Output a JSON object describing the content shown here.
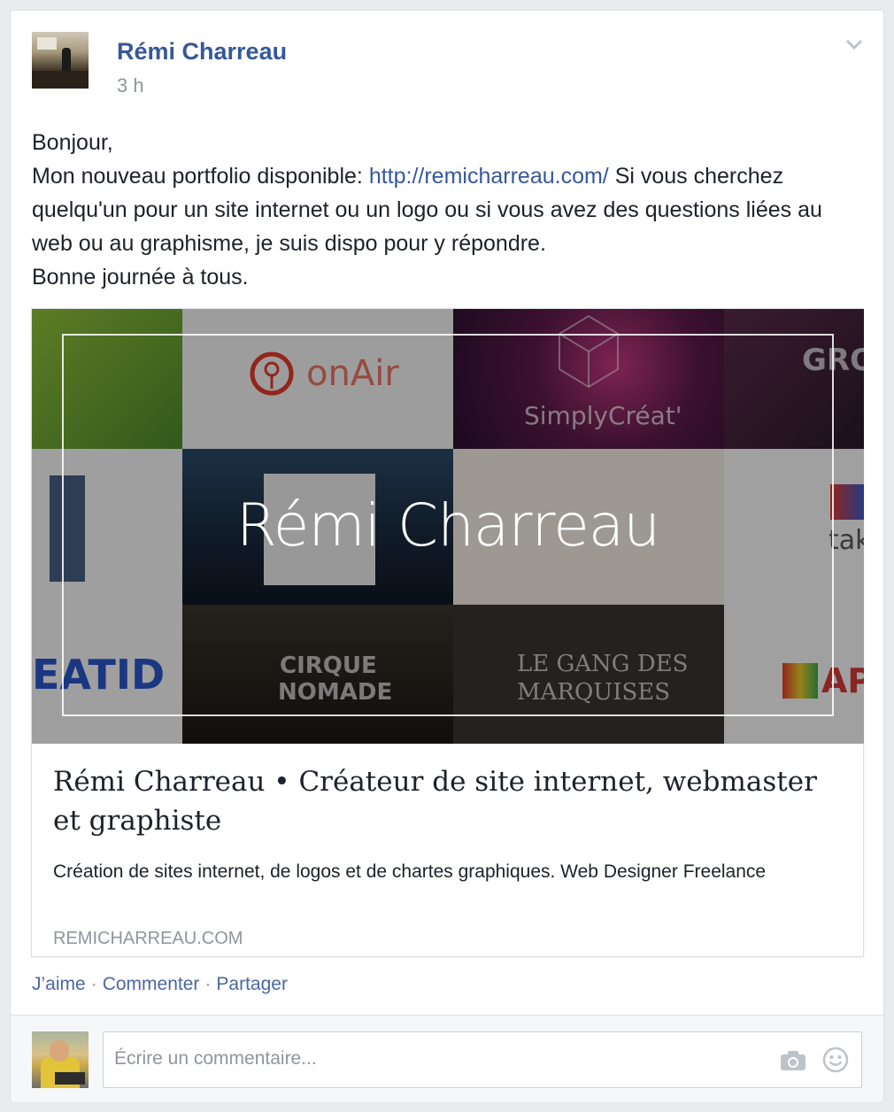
{
  "post": {
    "author": "Rémi Charreau",
    "time": "3 h",
    "text_line1": "Bonjour,",
    "text_prefix": "Mon nouveau portfolio disponible: ",
    "link_url": "http://remicharreau.com/",
    "text_suffix": " Si vous cherchez quelqu'un pour un site internet ou un logo ou si vous avez des questions liées au web ou au graphisme, je suis dispo pour y répondre.",
    "text_last": "Bonne journée à tous."
  },
  "link_preview": {
    "image_title": "Rémi Charreau",
    "tiles": {
      "onair": "onAir",
      "simply": "SimplyCréat'",
      "gro": "GRO",
      "tak": "tak",
      "eatid": "EATID",
      "cirque1": "CIRQUE",
      "cirque2": "NOMADE",
      "gang1": "LE GANG DES",
      "gang2": "MARQUISES",
      "ap": "AP"
    },
    "title": "Rémi Charreau • Créateur de site internet, webmaster et graphiste",
    "description": "Création de sites internet, de logos et de chartes graphiques. Web Designer Freelance",
    "domain": "REMICHARREAU.COM"
  },
  "actions": {
    "like": "J’aime",
    "comment": "Commenter",
    "share": "Partager",
    "separator": "·"
  },
  "comment_box": {
    "placeholder": "Écrire un commentaire..."
  },
  "icons": {
    "menu": "chevron-down-icon",
    "camera": "camera-icon",
    "emoji": "smile-icon"
  },
  "colors": {
    "link_blue": "#365899",
    "action_blue": "#4b67a1",
    "meta_gray": "#90949c"
  }
}
